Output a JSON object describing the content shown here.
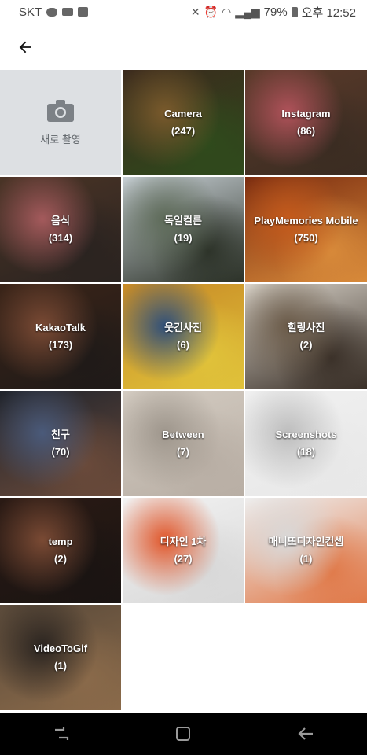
{
  "status_bar": {
    "carrier": "SKT",
    "battery": "79%",
    "time": "오후 12:52",
    "icons": [
      "kakaotalk-icon",
      "video-icon",
      "check-icon",
      "mute-icon",
      "alarm-icon",
      "wifi-icon",
      "signal-icon",
      "battery-icon"
    ]
  },
  "app_bar": {
    "back_icon": "arrow-left-icon"
  },
  "new_photo": {
    "label": "새로 촬영",
    "icon": "camera-icon"
  },
  "albums": [
    {
      "name": "Camera",
      "count": "(247)",
      "colors": [
        "#3b2a1d",
        "#7a5a2c",
        "#2f4a1c"
      ]
    },
    {
      "name": "Instagram",
      "count": "(86)",
      "colors": [
        "#5a3a2a",
        "#b0525a",
        "#3a2c22"
      ]
    },
    {
      "name": "음식",
      "count": "(314)",
      "colors": [
        "#4a3426",
        "#a45a5c",
        "#2a2320"
      ]
    },
    {
      "name": "독일컬른",
      "count": "(19)",
      "colors": [
        "#c7cfd4",
        "#5d6a58",
        "#2c3228"
      ]
    },
    {
      "name": "PlayMemories Mobile",
      "count": "(750)",
      "colors": [
        "#7a2c10",
        "#c45a1c",
        "#d88a3a"
      ]
    },
    {
      "name": "KakaoTalk",
      "count": "(173)",
      "colors": [
        "#3a2418",
        "#7a4a34",
        "#1f1a18"
      ]
    },
    {
      "name": "웃긴사진",
      "count": "(6)",
      "colors": [
        "#c88a26",
        "#2f4f7a",
        "#e0c23a"
      ]
    },
    {
      "name": "힐링사진",
      "count": "(2)",
      "colors": [
        "#d8d2c8",
        "#6a5a48",
        "#3a3028"
      ]
    },
    {
      "name": "친구",
      "count": "(70)",
      "colors": [
        "#20242c",
        "#4a5a7a",
        "#6a4a3a"
      ]
    },
    {
      "name": "Between",
      "count": "(7)",
      "colors": [
        "#d4ccc2",
        "#9e968c",
        "#b8aea4"
      ]
    },
    {
      "name": "Screenshots",
      "count": "(18)",
      "colors": [
        "#f0f0f0",
        "#bdbdbd",
        "#e8e8e8"
      ]
    },
    {
      "name": "temp",
      "count": "(2)",
      "colors": [
        "#2a1a14",
        "#7a4a34",
        "#1a1412"
      ]
    },
    {
      "name": "디자인 1차",
      "count": "(27)",
      "colors": [
        "#f2f2f2",
        "#e0562a",
        "#d8d8d8"
      ]
    },
    {
      "name": "매니또디자인컨셉",
      "count": "(1)",
      "colors": [
        "#eeeeee",
        "#d8d8d8",
        "#e07a4a"
      ]
    },
    {
      "name": "VideoToGif",
      "count": "(1)",
      "colors": [
        "#5a4a3a",
        "#2a2420",
        "#8a6a4a"
      ]
    }
  ],
  "nav_bar": {
    "buttons": [
      "recent-apps-icon",
      "home-icon",
      "back-icon"
    ]
  }
}
